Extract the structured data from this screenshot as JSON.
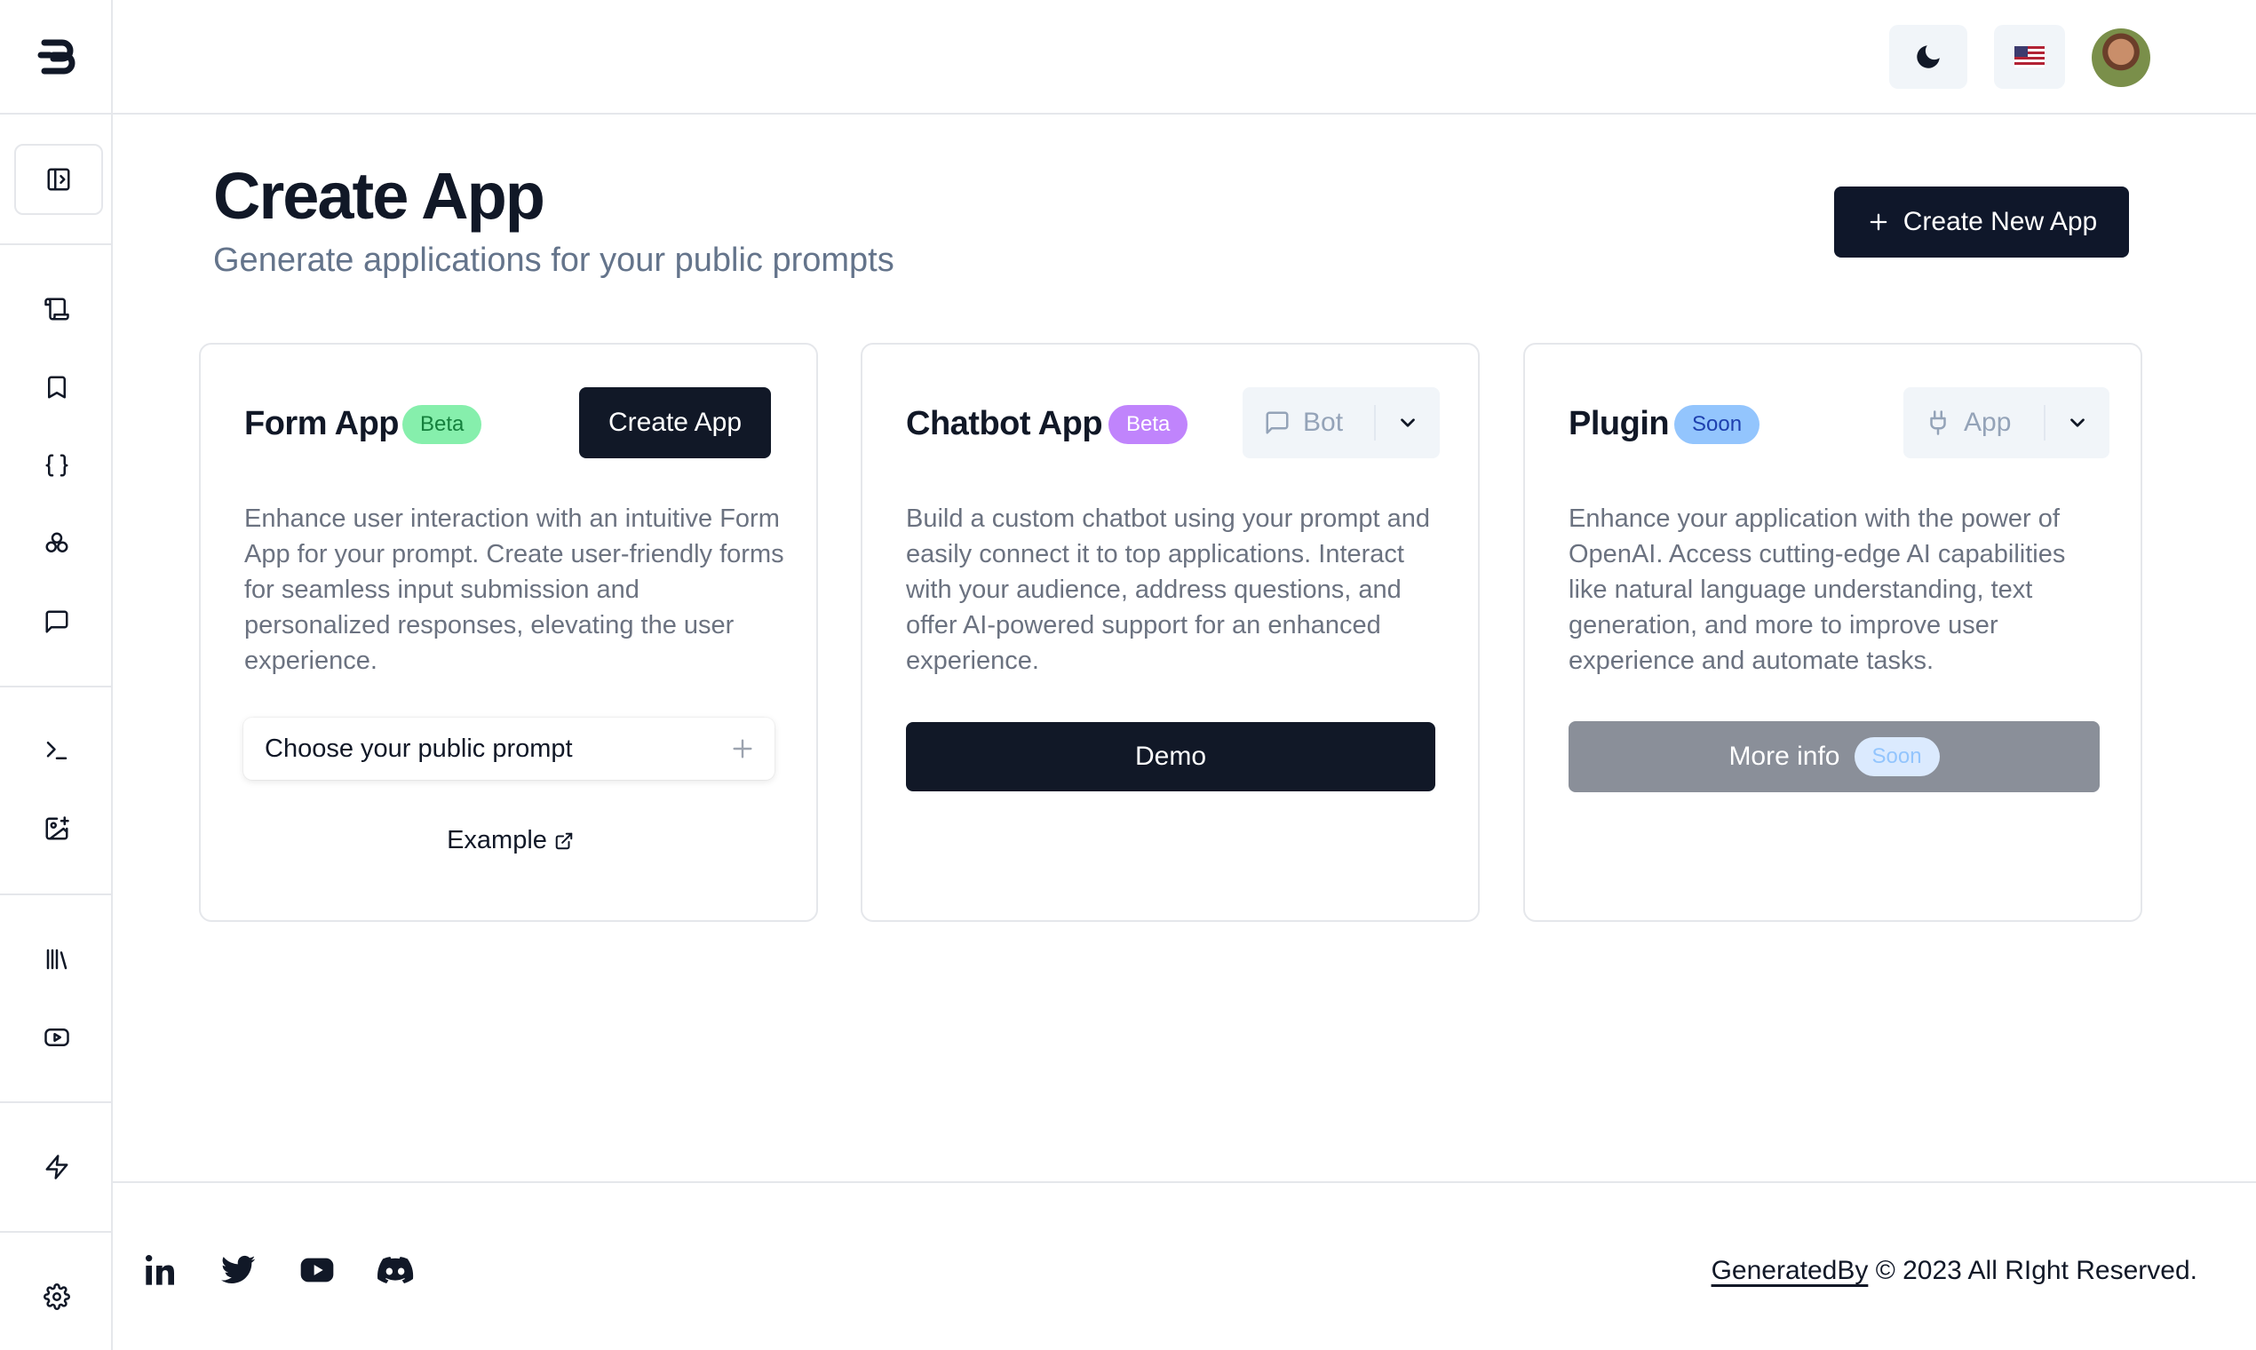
{
  "sidebar": {
    "logo": "logo-icon",
    "toggle_icon": "sidebar-toggle-icon",
    "items": [
      {
        "icon": "scroll-icon"
      },
      {
        "icon": "bookmark-icon"
      },
      {
        "icon": "braces-icon"
      },
      {
        "icon": "puzzle-icon"
      },
      {
        "icon": "message-icon"
      },
      {
        "icon": "terminal-icon"
      },
      {
        "icon": "image-plus-icon"
      },
      {
        "icon": "library-icon"
      },
      {
        "icon": "youtube-icon"
      },
      {
        "icon": "zap-icon"
      },
      {
        "icon": "settings-icon"
      }
    ]
  },
  "header": {
    "theme_icon": "moon-icon",
    "language_icon": "us-flag-icon",
    "avatar": "user-avatar"
  },
  "page": {
    "title": "Create App",
    "subtitle": "Generate applications for your public prompts",
    "create_new_label": "Create New App"
  },
  "cards": [
    {
      "title": "Form App",
      "badge": "Beta",
      "action_label": "Create App",
      "description": "Enhance user interaction with an intuitive Form App for your prompt. Create user-friendly forms for seamless input submission and personalized responses, elevating the user experience.",
      "prompt_placeholder": "Choose your public prompt",
      "example_label": "Example"
    },
    {
      "title": "Chatbot App",
      "badge": "Beta",
      "select_label": "Bot",
      "description": "Build a custom chatbot using your prompt and easily connect it to top applications. Interact with your audience, address questions, and offer AI-powered support for an enhanced experience.",
      "demo_label": "Demo"
    },
    {
      "title": "Plugin",
      "badge": "Soon",
      "select_label": "App",
      "description": "Enhance your application with the power of OpenAI. Access cutting-edge AI capabilities like natural language understanding, text generation, and more to improve user experience and automate tasks.",
      "more_info_label": "More info",
      "more_info_badge": "Soon"
    }
  ],
  "footer": {
    "social": [
      "linkedin-icon",
      "twitter-icon",
      "youtube-icon",
      "discord-icon"
    ],
    "brand_link": "GeneratedBy",
    "copyright": "© 2023 All RIght Reserved."
  },
  "colors": {
    "primary": "#111827",
    "beta_green_bg": "#86efac",
    "beta_green_text": "#15803d",
    "beta_purple_bg": "#c084fc",
    "soon_blue_bg": "#93c5fd",
    "soon_blue_text": "#1e40af"
  }
}
